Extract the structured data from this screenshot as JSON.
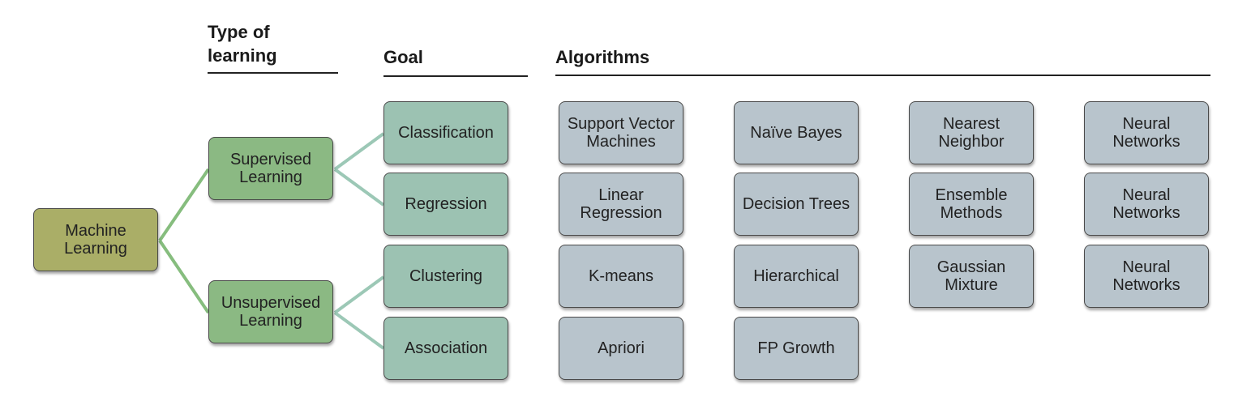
{
  "headers": {
    "type_of_learning": "Type of\nlearning",
    "goal": "Goal",
    "algorithms": "Algorithms"
  },
  "root": {
    "label": "Machine Learning"
  },
  "types": [
    {
      "label": "Supervised Learning"
    },
    {
      "label": "Unsupervised Learning"
    }
  ],
  "goals": [
    {
      "label": "Classification",
      "type": "Supervised Learning"
    },
    {
      "label": "Regression",
      "type": "Supervised Learning"
    },
    {
      "label": "Clustering",
      "type": "Unsupervised Learning"
    },
    {
      "label": "Association",
      "type": "Unsupervised Learning"
    }
  ],
  "algorithms": [
    [
      "Support Vector Machines",
      "Naïve Bayes",
      "Nearest Neighbor",
      "Neural Networks"
    ],
    [
      "Linear Regression",
      "Decision Trees",
      "Ensemble Methods",
      "Neural Networks"
    ],
    [
      "K-means",
      "Hierarchical",
      "Gaussian Mixture",
      "Neural Networks"
    ],
    [
      "Apriori",
      "FP Growth"
    ]
  ],
  "colors": {
    "root": "#aaae67",
    "type": "#8bb983",
    "goal": "#9cc2b2",
    "algorithm": "#b8c4cc",
    "link_root": "#86bd7e",
    "link_type": "#9cc8b6"
  }
}
